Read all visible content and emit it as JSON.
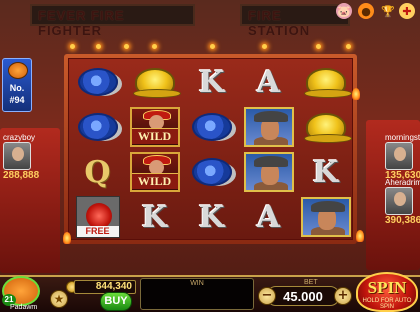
{
  "scene": {
    "sign_left": "FEVER FIRE FIGHTER",
    "sign_right": "FIRE STATION"
  },
  "top_icons": [
    {
      "name": "piggy-bank-icon",
      "glyph": "🐷"
    },
    {
      "name": "pumpkin-icon",
      "glyph": "●"
    },
    {
      "name": "trophy-icon",
      "glyph": "🏆"
    },
    {
      "name": "gift-icon",
      "glyph": "✚"
    },
    {
      "name": "settings-icon",
      "glyph": "⚙"
    }
  ],
  "jackpot": {
    "label": "No.",
    "number": "#94"
  },
  "players": {
    "left": {
      "name": "crazyboy",
      "score": "288,888"
    },
    "right_top": {
      "name": "morningsta",
      "score": "135,630"
    },
    "right_bottom": {
      "name": "Aheradrim",
      "score": "390,386"
    }
  },
  "reels": [
    [
      "hose",
      "hose",
      "Q",
      "bell"
    ],
    [
      "helmet",
      "wild",
      "wild",
      "K"
    ],
    [
      "K",
      "hose",
      "hose",
      "K"
    ],
    [
      "A",
      "man",
      "man",
      "A"
    ],
    [
      "helmet",
      "helmet",
      "K",
      "man"
    ]
  ],
  "symbol_text": {
    "wild": "WILD",
    "free": "FREE"
  },
  "bottom": {
    "level": "21",
    "player_name": "Padawm",
    "balance": "844,340",
    "buy_label": "BUY",
    "win_label": "WIN",
    "bet_label": "BET",
    "bet_value": "45.000",
    "minus": "−",
    "plus": "+",
    "spin_label": "SPIN",
    "spin_hint": "HOLD FOR AUTO SPIN"
  },
  "colors": {
    "accent": "#ffcf4a",
    "buy": "#1a8a12",
    "spin": "#c0140c"
  }
}
